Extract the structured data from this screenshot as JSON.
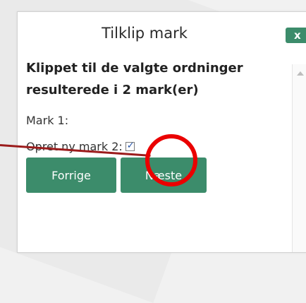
{
  "dialog": {
    "title": "Tilklip mark",
    "close_label": "x",
    "heading": "Klippet til de valgte ordninger resulterede i 2 mark(er)",
    "mark1_label": "Mark 1:",
    "create_new_label": "Opret ny mark 2:",
    "create_new_checked": true,
    "prev_button": "Forrige",
    "next_button": "Næste"
  },
  "colors": {
    "button_green": "#3c8c6b",
    "annotation_red": "#ea0000"
  }
}
